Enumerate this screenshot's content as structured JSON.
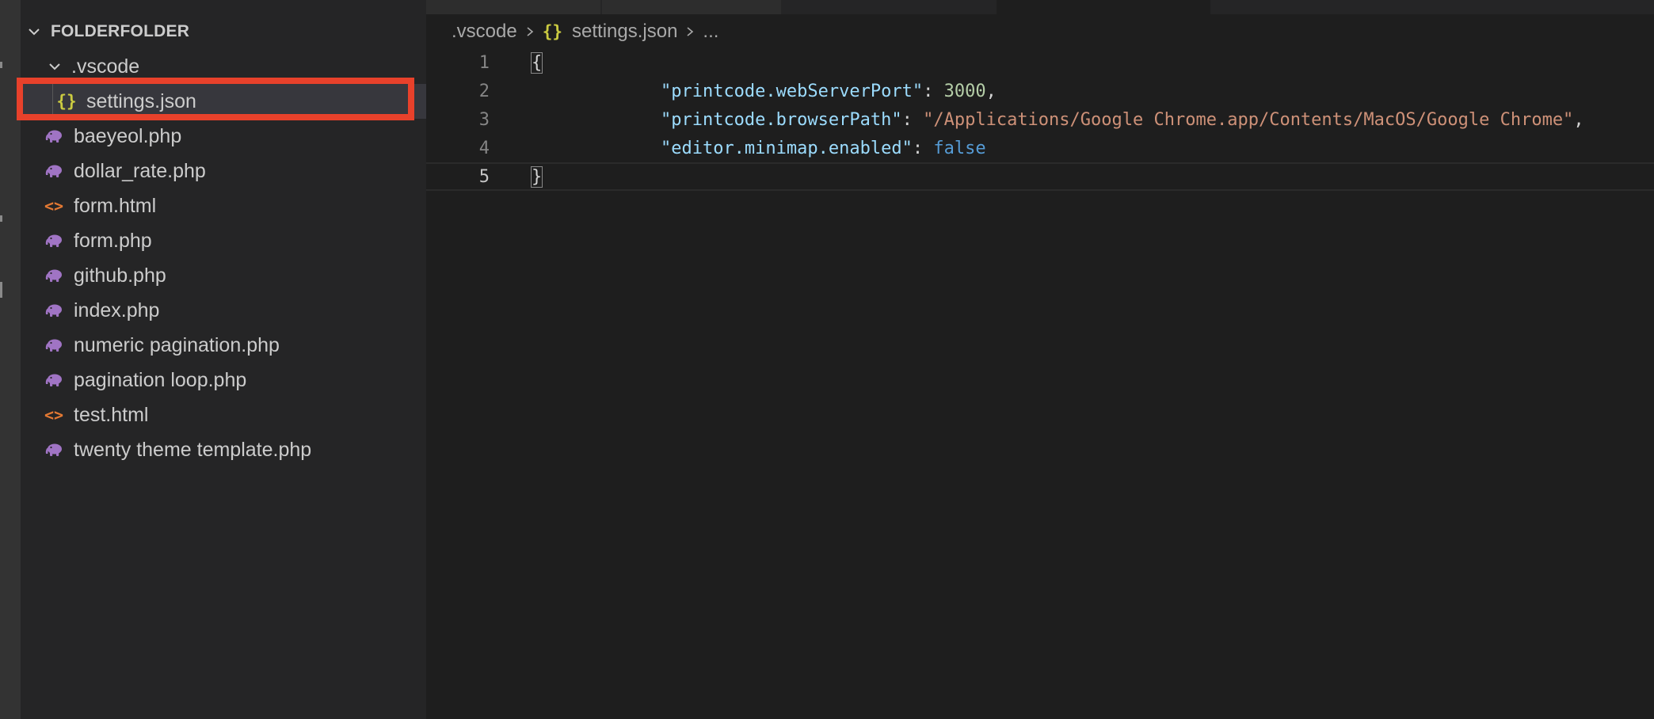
{
  "colors": {
    "editor_bg": "#1e1e1e",
    "sidebar_bg": "#252526",
    "selection_bg": "#37373d",
    "highlight_border": "#e8412b",
    "php_icon": "#a074c4",
    "html_icon": "#e37933",
    "json_icon": "#cbcb41"
  },
  "explorer": {
    "folder_name": "FOLDERFOLDER",
    "subfolder": ".vscode",
    "selected_file": "settings.json",
    "files": [
      {
        "name": "baeyeol.php",
        "icon": "php-elephant-icon"
      },
      {
        "name": "dollar_rate.php",
        "icon": "php-elephant-icon"
      },
      {
        "name": "form.html",
        "icon": "html-brackets-icon"
      },
      {
        "name": "form.php",
        "icon": "php-elephant-icon"
      },
      {
        "name": "github.php",
        "icon": "php-elephant-icon"
      },
      {
        "name": "index.php",
        "icon": "php-elephant-icon"
      },
      {
        "name": "numeric pagination.php",
        "icon": "php-elephant-icon"
      },
      {
        "name": "pagination loop.php",
        "icon": "php-elephant-icon"
      },
      {
        "name": "test.html",
        "icon": "html-brackets-icon"
      },
      {
        "name": "twenty theme template.php",
        "icon": "php-elephant-icon"
      }
    ]
  },
  "breadcrumb": {
    "folder": ".vscode",
    "file": "settings.json",
    "ellipsis": "..."
  },
  "editor": {
    "json_icon_text": "{}",
    "lines": [
      {
        "number": "1",
        "open_brace": "{"
      },
      {
        "number": "2",
        "key": "\"printcode.webServerPort\"",
        "colon": ": ",
        "value": "3000",
        "trail": ","
      },
      {
        "number": "3",
        "key": "\"printcode.browserPath\"",
        "colon": ": ",
        "value": "\"/Applications/Google Chrome.app/Contents/MacOS/Google Chrome\"",
        "trail": ","
      },
      {
        "number": "4",
        "key": "\"editor.minimap.enabled\"",
        "colon": ": ",
        "value": "false",
        "trail": ""
      },
      {
        "number": "5",
        "close_brace": "}"
      }
    ]
  }
}
